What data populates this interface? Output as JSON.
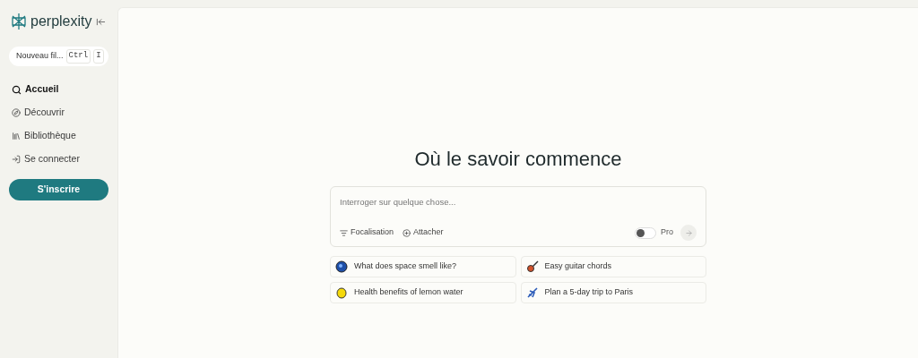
{
  "sidebar": {
    "logo": "perplexity",
    "new_thread": {
      "label": "Nouveau fil...",
      "keys": [
        "Ctrl",
        "I"
      ]
    },
    "items": [
      {
        "label": "Accueil",
        "kind": "search",
        "selected": true
      },
      {
        "label": "Découvrir",
        "kind": "compass",
        "selected": false
      },
      {
        "label": "Bibliothèque",
        "kind": "library",
        "selected": false
      },
      {
        "label": "Se connecter",
        "kind": "login",
        "selected": false
      }
    ],
    "signup": "S'inscrire"
  },
  "main": {
    "heading": "Où le savoir commence",
    "search": {
      "placeholder": "Interroger sur quelque chose...",
      "focus": "Focalisation",
      "attach": "Attacher",
      "pro": {
        "label": "Pro",
        "on": false
      }
    },
    "suggestions": [
      {
        "label": "What does space smell like?",
        "kind": "space"
      },
      {
        "label": "Easy guitar chords",
        "kind": "guitar"
      },
      {
        "label": "Health benefits of lemon water",
        "kind": "lemon"
      },
      {
        "label": "Plan a 5-day trip to Paris",
        "kind": "plane"
      }
    ]
  }
}
